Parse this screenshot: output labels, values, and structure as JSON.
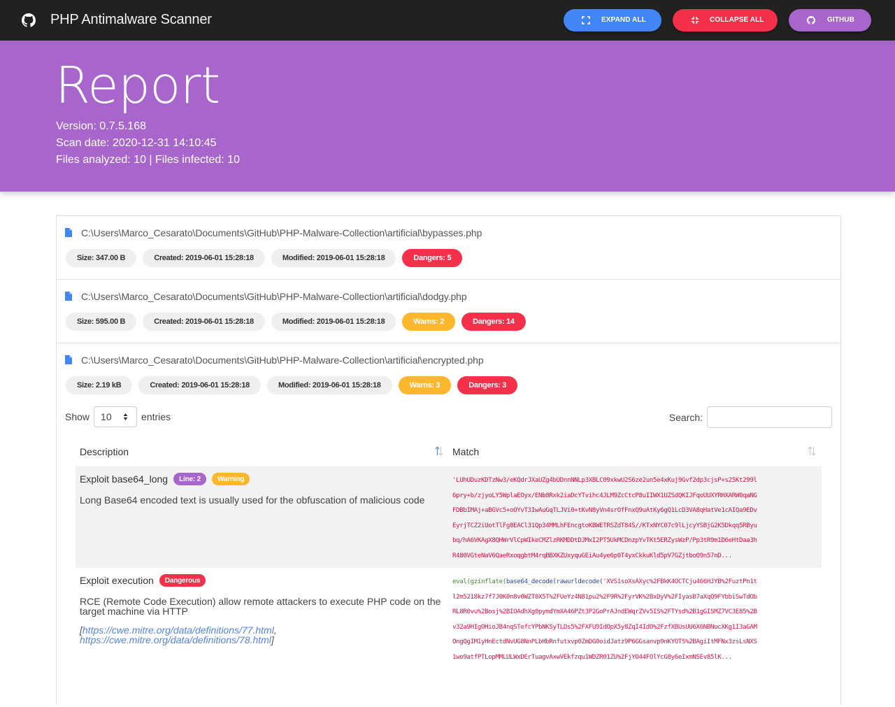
{
  "navbar": {
    "title": "PHP Antimalware Scanner",
    "logo_icon": "github-icon",
    "buttons": [
      {
        "label": "EXPAND ALL",
        "icon": "expand-icon",
        "color": "#4285f4"
      },
      {
        "label": "COLLAPSE ALL",
        "icon": "collapse-icon",
        "color": "#f4304a"
      },
      {
        "label": "GITHUB",
        "icon": "github-icon",
        "color": "#a865cc"
      }
    ]
  },
  "hero": {
    "title": "Report",
    "version": "Version: 0.7.5.168",
    "scan_date": "Scan date: 2020-12-31 14:10:45",
    "files_summary": "Files analyzed: 10 | Files infected: 10",
    "background": "#a865cc"
  },
  "files": [
    {
      "path": "C:\\Users\\Marco_Cesarato\\Documents\\GitHub\\PHP-Malware-Collection\\artificial\\bypasses.php",
      "size": "Size: 347.00 B",
      "created": "Created: 2019-06-01 15:28:18",
      "modified": "Modified: 2019-06-01 15:28:18",
      "dangers": "Dangers: 5"
    },
    {
      "path": "C:\\Users\\Marco_Cesarato\\Documents\\GitHub\\PHP-Malware-Collection\\artificial\\dodgy.php",
      "size": "Size: 595.00 B",
      "created": "Created: 2019-06-01 15:28:18",
      "modified": "Modified: 2019-06-01 15:28:18",
      "warns": "Warns: 2",
      "dangers": "Dangers: 14"
    },
    {
      "path": "C:\\Users\\Marco_Cesarato\\Documents\\GitHub\\PHP-Malware-Collection\\artificial\\encrypted.php",
      "size": "Size: 2.19 kB",
      "created": "Created: 2019-06-01 15:28:18",
      "modified": "Modified: 2019-06-01 15:28:18",
      "warns": "Warns: 3",
      "dangers": "Dangers: 3"
    }
  ],
  "datatable": {
    "show_label": "Show",
    "entries_value": "10",
    "entries_label": "entries",
    "search_label": "Search:",
    "search_value": "",
    "columns": [
      "Description",
      "Match"
    ],
    "rows": [
      {
        "title": "Exploit base64_long",
        "line_badge": "Line: 2",
        "level_badge": "Warning",
        "description": "Long Base64 encoded text is usually used for the obfuscation of malicious code",
        "match_lines": [
          "'LUhUDuzKDTzNw3/eKQdrJXaUZg4bUDnnNNLp3XBLC09xkwU2S6ze2un5e4xKuj9Gvf2dp3cjsP+s25Kt299l",
          "6pry+b/zjyoLY5WplaEOyx/ENb8Rxk2iaDcYTvihc4JLM9ZcCtcP8uIIWX1UZSdQKIJFqoUUXYRHXARW0qaNG",
          "FDBbIMAj+aBGVc5+oOYvT3IwAuGqTLJVi0+tKvN8yVn4srOfFnxQ9uAtKy6gQ1LcD3VA8qHatVe1cAIQa9EDv",
          "EyrjTCZ2iUotTlFg8EACl31Qp34MMLhFEncgtoKBWETRSZdT84S//KTxNYC07c9lLjcyYSBjG2K5Dkqq5RByu",
          "bq/hA6VKAgX8QHWrVlCpWIkeCMZlzRKMDDtDJMxI2PT5UkMCDnzpYvTKt5ERZysWzP/Pp3tR9m1D6eHtDaa3h",
          "R480VGteNaV6QaeRxoqgbtM4rqBBXKZUxyquGEiAu4ye6p0T4yxCkkuKld5pV7GZjtboO9n57nD..."
        ]
      },
      {
        "title": "Exploit execution",
        "level_badge": "Dangerous",
        "description": "RCE (Remote Code Execution) allow remote attackers to execute PHP code on the target machine via HTTP",
        "links": [
          "https://cwe.mitre.org/data/definitions/77.html",
          "https://cwe.mitre.org/data/definitions/78.html"
        ],
        "match_prefix_fn1": "eval(",
        "match_prefix_fn2": "gzinflate(",
        "match_prefix_fn3": "base64_decode(",
        "match_prefix_fn4": "rawurldecode(",
        "match_first_rest": "'XVS1soXsAXyc%2FBkK4OCTCju466HJYB%2FuztPn1t",
        "match_lines": [
          "l2m5218kz7f7J0K0n8v0WZT0X5T%2FUeYz4N81pu2%2F9R%2FyrVK%2BxDyV%2FIyasB7aXqQ9FYbbiSwTdOb",
          "RL8R0vu%2Bosj%2BIOAdhXg0pymdYmXA46PZt3P2GoPrAJndEWqrZVv5IS%2FTYsd%2B1gGISMZ7VC3E85%2B",
          "v32a9HIgOHioJB4nqSTefcYPbNKSyTLDs5%2FXFU9IdOpX5y8ZqI4IdO%2FzfXBUsUU6X6NBNucXKg1I3aGAM",
          "OngQgIM1yHnEctdNvUG8NnPLbHbRnfutxvp0ZmDG0oidJatz9P6GGsanvp9nKYOTS%2BAgiItMFNx3zsLsNXS",
          "1wo9atfPTLopMMLULWxDErTuagvAxwVEkfzqu1WDZR01ZU%2FjYO44FOlYcG8y6eIxmNSEv85lK..."
        ]
      }
    ]
  }
}
